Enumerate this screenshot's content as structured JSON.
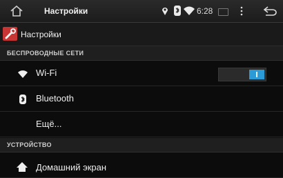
{
  "statusbar": {
    "app_name": "Настройки",
    "time": "6:28",
    "icons": [
      "home-icon",
      "location-icon",
      "bluetooth-icon",
      "wifi-icon",
      "keyboard-icon",
      "overflow-menu-icon",
      "back-icon"
    ]
  },
  "actionbar": {
    "title": "Настройки",
    "icon": "settings-app-icon",
    "icon_color": "#c73535"
  },
  "sections": {
    "wireless": "БЕСПРОВОДНЫЕ СЕТИ",
    "device": "УСТРОЙСТВО"
  },
  "items": {
    "wifi": {
      "label": "Wi-Fi",
      "toggle_state": "on",
      "accent": "#2b9bd7"
    },
    "bluetooth": {
      "label": "Bluetooth"
    },
    "more": {
      "label": "Ещё..."
    },
    "home_screen": {
      "label": "Домашний экран"
    }
  }
}
